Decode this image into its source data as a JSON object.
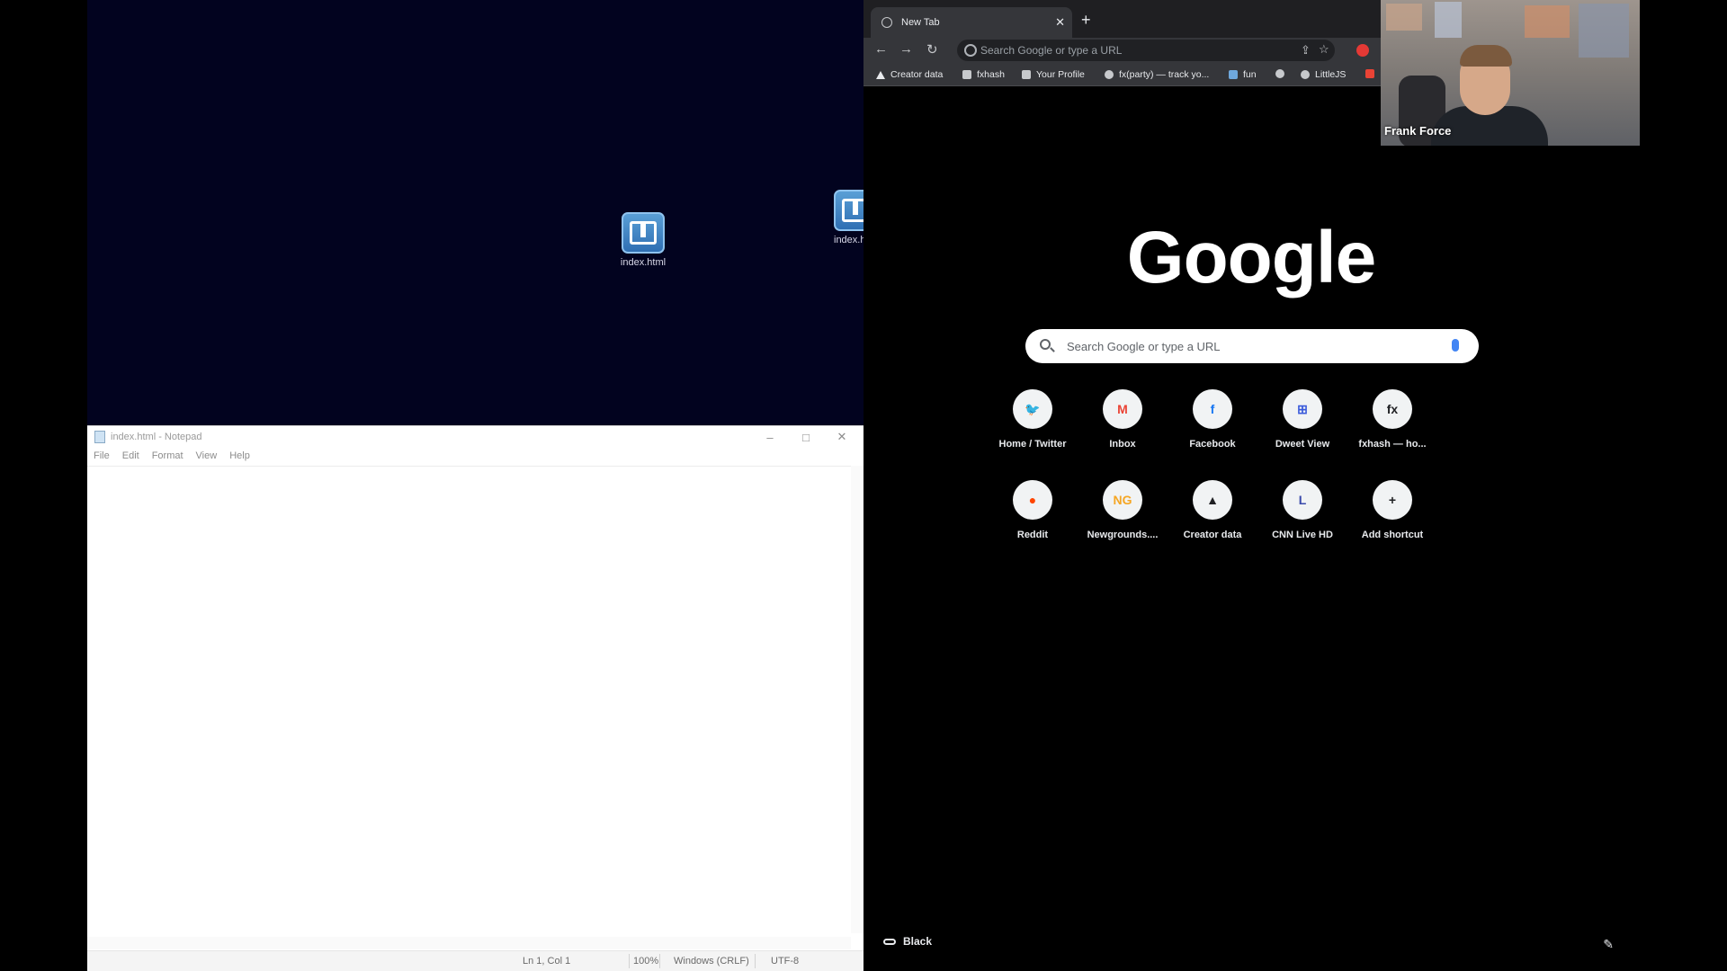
{
  "desktop": {
    "icons": [
      {
        "label": "index.html"
      },
      {
        "label": "index.h"
      }
    ]
  },
  "notepad": {
    "title": "index.html - Notepad",
    "controls": {
      "minimize": "–",
      "maximize": "□",
      "close": "✕"
    },
    "menu": [
      "File",
      "Edit",
      "Format",
      "View",
      "Help"
    ],
    "status": {
      "position": "Ln 1, Col 1",
      "zoom": "100%",
      "line_ending": "Windows (CRLF)",
      "encoding": "UTF-8"
    }
  },
  "chrome": {
    "tab": {
      "title": "New Tab",
      "close": "✕"
    },
    "new_tab": "+",
    "nav": {
      "back": "←",
      "forward": "→",
      "reload": "↻"
    },
    "omnibox_placeholder": "Search Google or type a URL",
    "toolbar_icons": {
      "share": "⇪",
      "bookmark_star": "☆"
    },
    "bookmarks": [
      "Creator data",
      "fxhash",
      "Your Profile",
      "fx(party) — track yo...",
      "fun",
      "",
      "LittleJS",
      ""
    ],
    "logo": "Google",
    "search_placeholder": "Search Google or type a URL",
    "shortcuts": [
      {
        "label": "Home / Twitter",
        "glyph": "🐦",
        "color": "#1d9bf0"
      },
      {
        "label": "Inbox",
        "glyph": "M",
        "color": "#ea4335"
      },
      {
        "label": "Facebook",
        "glyph": "f",
        "color": "#1877f2"
      },
      {
        "label": "Dweet View",
        "glyph": "⊞",
        "color": "#3b5bdb"
      },
      {
        "label": "fxhash — ho...",
        "glyph": "fx",
        "color": "#202124"
      },
      {
        "label": "Reddit",
        "glyph": "●",
        "color": "#ff4500"
      },
      {
        "label": "Newgrounds....",
        "glyph": "NG",
        "color": "#f5a623"
      },
      {
        "label": "Creator data",
        "glyph": "▲",
        "color": "#202124"
      },
      {
        "label": "CNN Live HD",
        "glyph": "L",
        "color": "#3949ab"
      },
      {
        "label": "Add shortcut",
        "glyph": "+",
        "color": "#202124"
      }
    ],
    "customize_label": "Black",
    "edit_icon": "✎"
  },
  "webcam": {
    "name": "Frank Force"
  }
}
